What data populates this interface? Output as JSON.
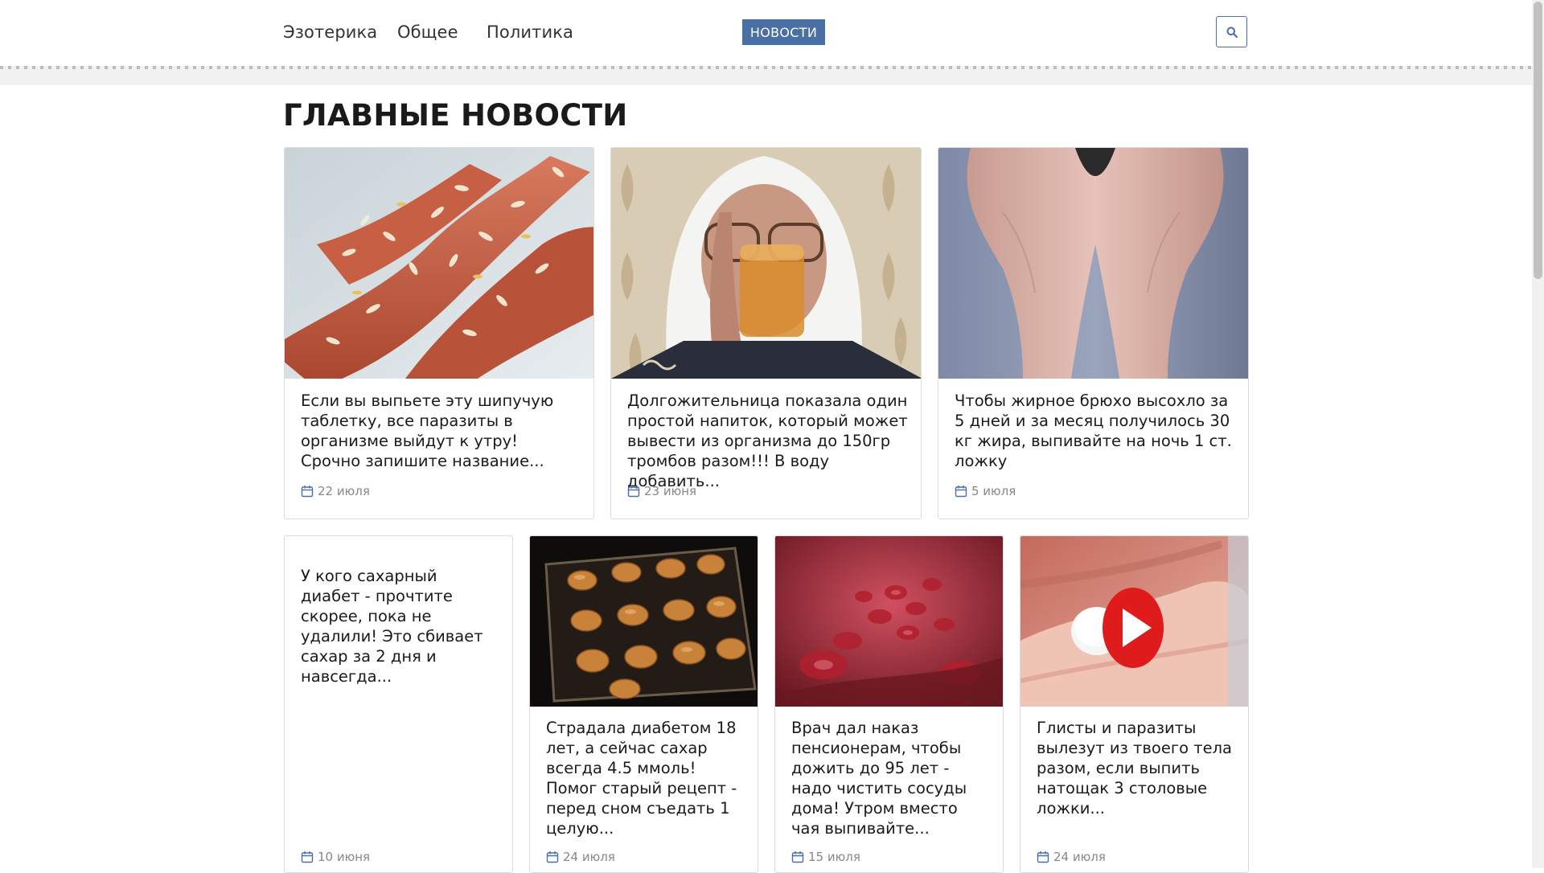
{
  "nav": {
    "links": [
      "Эзотерика",
      "Общее",
      "Политика"
    ],
    "news_button": "НОВОСТИ",
    "search_icon": "search-icon"
  },
  "section": {
    "title": "ГЛАВНЫЕ НОВОСТИ"
  },
  "cards": [
    {
      "text": "Если вы выпьете эту шипучую таблетку, все паразиты в организме выйдут к утру! Срочно запишите название...",
      "date": "22 июля"
    },
    {
      "text": "Долгожительница показала один простой напиток, который может вывести из организма до 150гр тромбов разом!!! В воду добавить...",
      "date": "23 июня"
    },
    {
      "text": "Чтобы жирное брюхо высохло за 5 дней и за месяц получилось 30 кг жира, выпивайте на ночь 1 ст. ложку",
      "date": "5 июля"
    },
    {
      "text": "У кого сахарный диабет - прочтите скорее, пока не удалили! Это сбивает сахар за 2 дня и навсегда...",
      "date": "10 июня"
    },
    {
      "text": "Страдала диабетом 18 лет, а сейчас сахар всегда 4.5 ммоль! Помог старый рецепт - перед сном съедать 1 целую...",
      "date": "24 июля"
    },
    {
      "text": "Врач дал наказ пенсионерам, чтобы дожить до 95 лет - надо чистить сосуды дома! Утром вместо чая выпивайте...",
      "date": "15 июля"
    },
    {
      "text": "Глисты и паразиты вылезут из твоего тела разом, если выпить натощак 3 столовые ложки...",
      "date": "24 июля"
    }
  ],
  "colors": {
    "accent": "#4a6fa5",
    "date": "#888888",
    "border": "#dcdcdc"
  }
}
